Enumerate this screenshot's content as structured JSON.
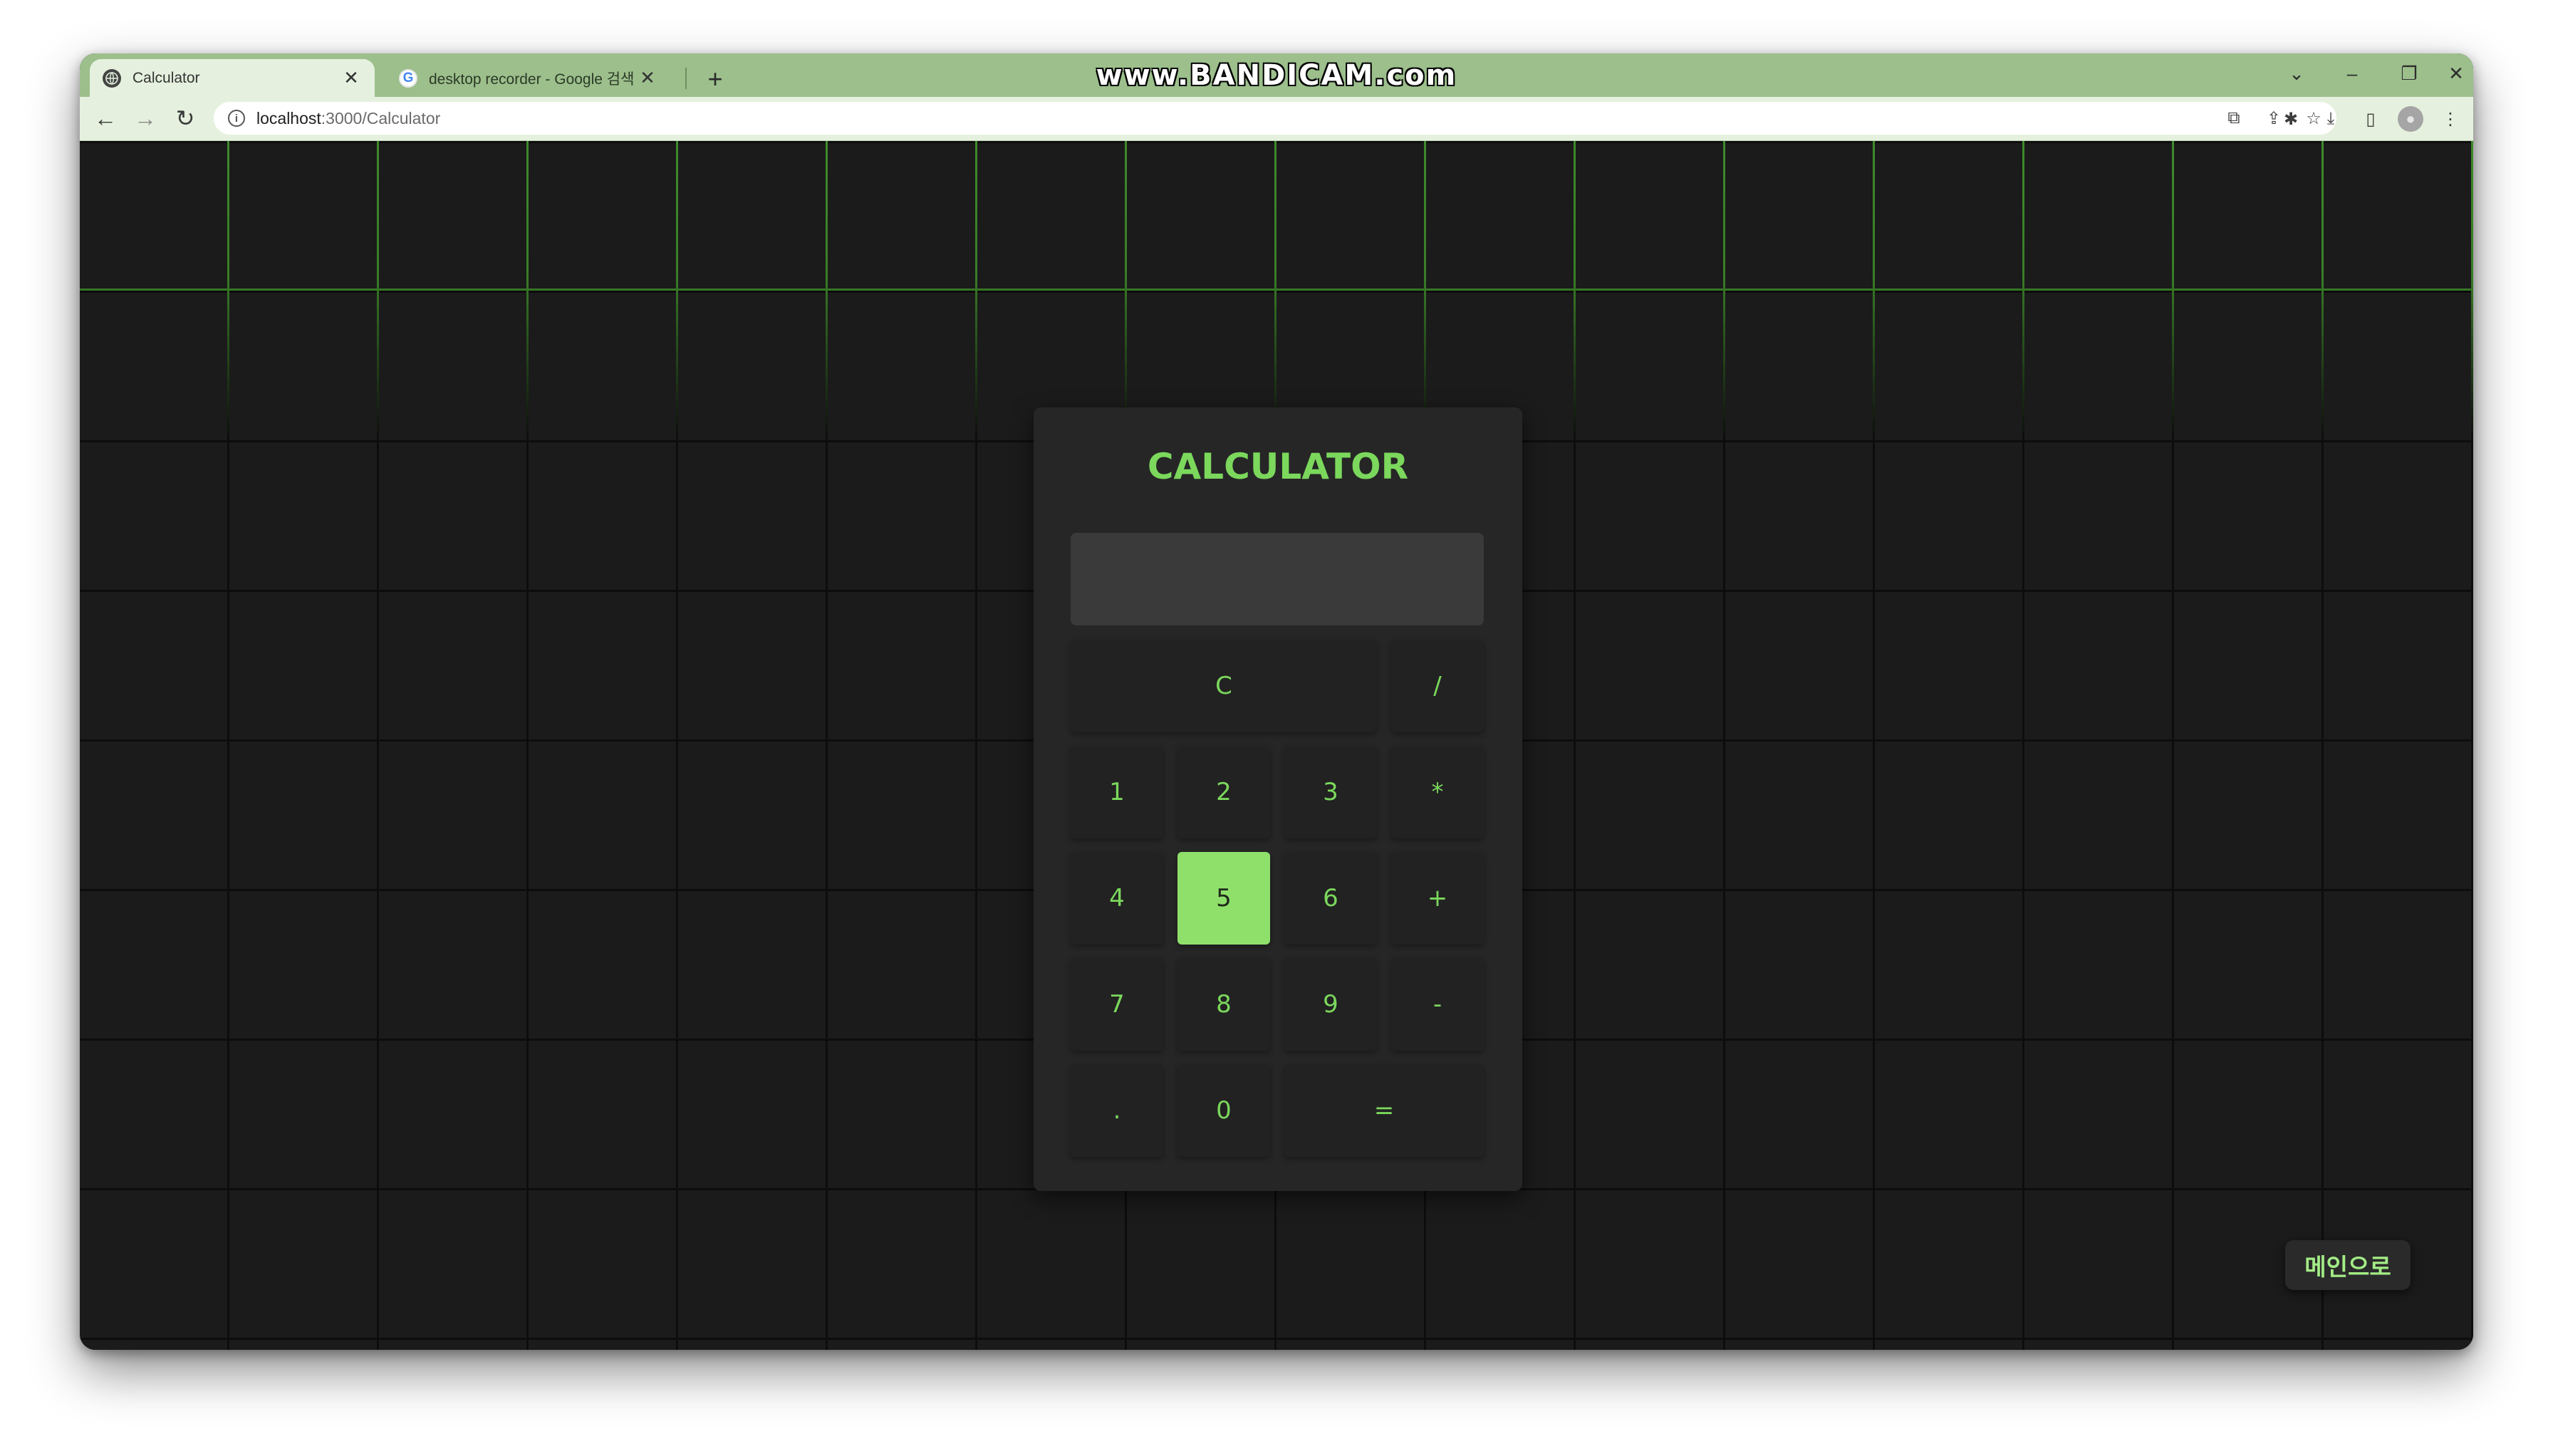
{
  "browser": {
    "watermark": "www.BANDICAM.com",
    "tabs": [
      {
        "title": "Calculator",
        "favicon": "globe-icon",
        "close": "✕"
      },
      {
        "title": "desktop recorder - Google 검색",
        "favicon": "google-icon",
        "favicon_glyph": "G",
        "close": "✕"
      }
    ],
    "new_tab": "+",
    "window_controls": {
      "tab_search": "⌄",
      "minimize": "–",
      "restore": "❐",
      "close": "✕"
    },
    "nav": {
      "back": "←",
      "forward": "→",
      "reload": "↻"
    },
    "address": {
      "host": "localhost",
      "path": ":3000/Calculator",
      "info_glyph": "i"
    },
    "omnibox_actions": [
      "translate-icon",
      "share-icon",
      "bookmark-star-icon"
    ],
    "toolbar_actions": [
      "extensions-icon",
      "download-icon",
      "side-panel-icon",
      "profile-avatar-icon",
      "menu-icon"
    ],
    "colors": {
      "tabstrip": "#9cbf8c",
      "toolbar": "#e5f1de"
    }
  },
  "calculator": {
    "title": "CALCULATOR",
    "display_value": "",
    "keys": [
      {
        "label": "C",
        "name": "clear-button"
      },
      {
        "label": "/",
        "name": "divide-button"
      },
      {
        "label": "1",
        "name": "digit-1-button"
      },
      {
        "label": "2",
        "name": "digit-2-button"
      },
      {
        "label": "3",
        "name": "digit-3-button"
      },
      {
        "label": "*",
        "name": "multiply-button"
      },
      {
        "label": "4",
        "name": "digit-4-button"
      },
      {
        "label": "5",
        "name": "digit-5-button",
        "active": true
      },
      {
        "label": "6",
        "name": "digit-6-button"
      },
      {
        "label": "+",
        "name": "add-button"
      },
      {
        "label": "7",
        "name": "digit-7-button"
      },
      {
        "label": "8",
        "name": "digit-8-button"
      },
      {
        "label": "9",
        "name": "digit-9-button"
      },
      {
        "label": "-",
        "name": "subtract-button"
      },
      {
        "label": ".",
        "name": "decimal-button"
      },
      {
        "label": "0",
        "name": "digit-0-button"
      },
      {
        "label": "=",
        "name": "equals-button"
      }
    ],
    "colors": {
      "accent": "#7bd85c",
      "active_key": "#8fe06b",
      "panel": "#262626",
      "display": "#3a3a3a"
    }
  },
  "main_button": {
    "label": "메인으로"
  }
}
